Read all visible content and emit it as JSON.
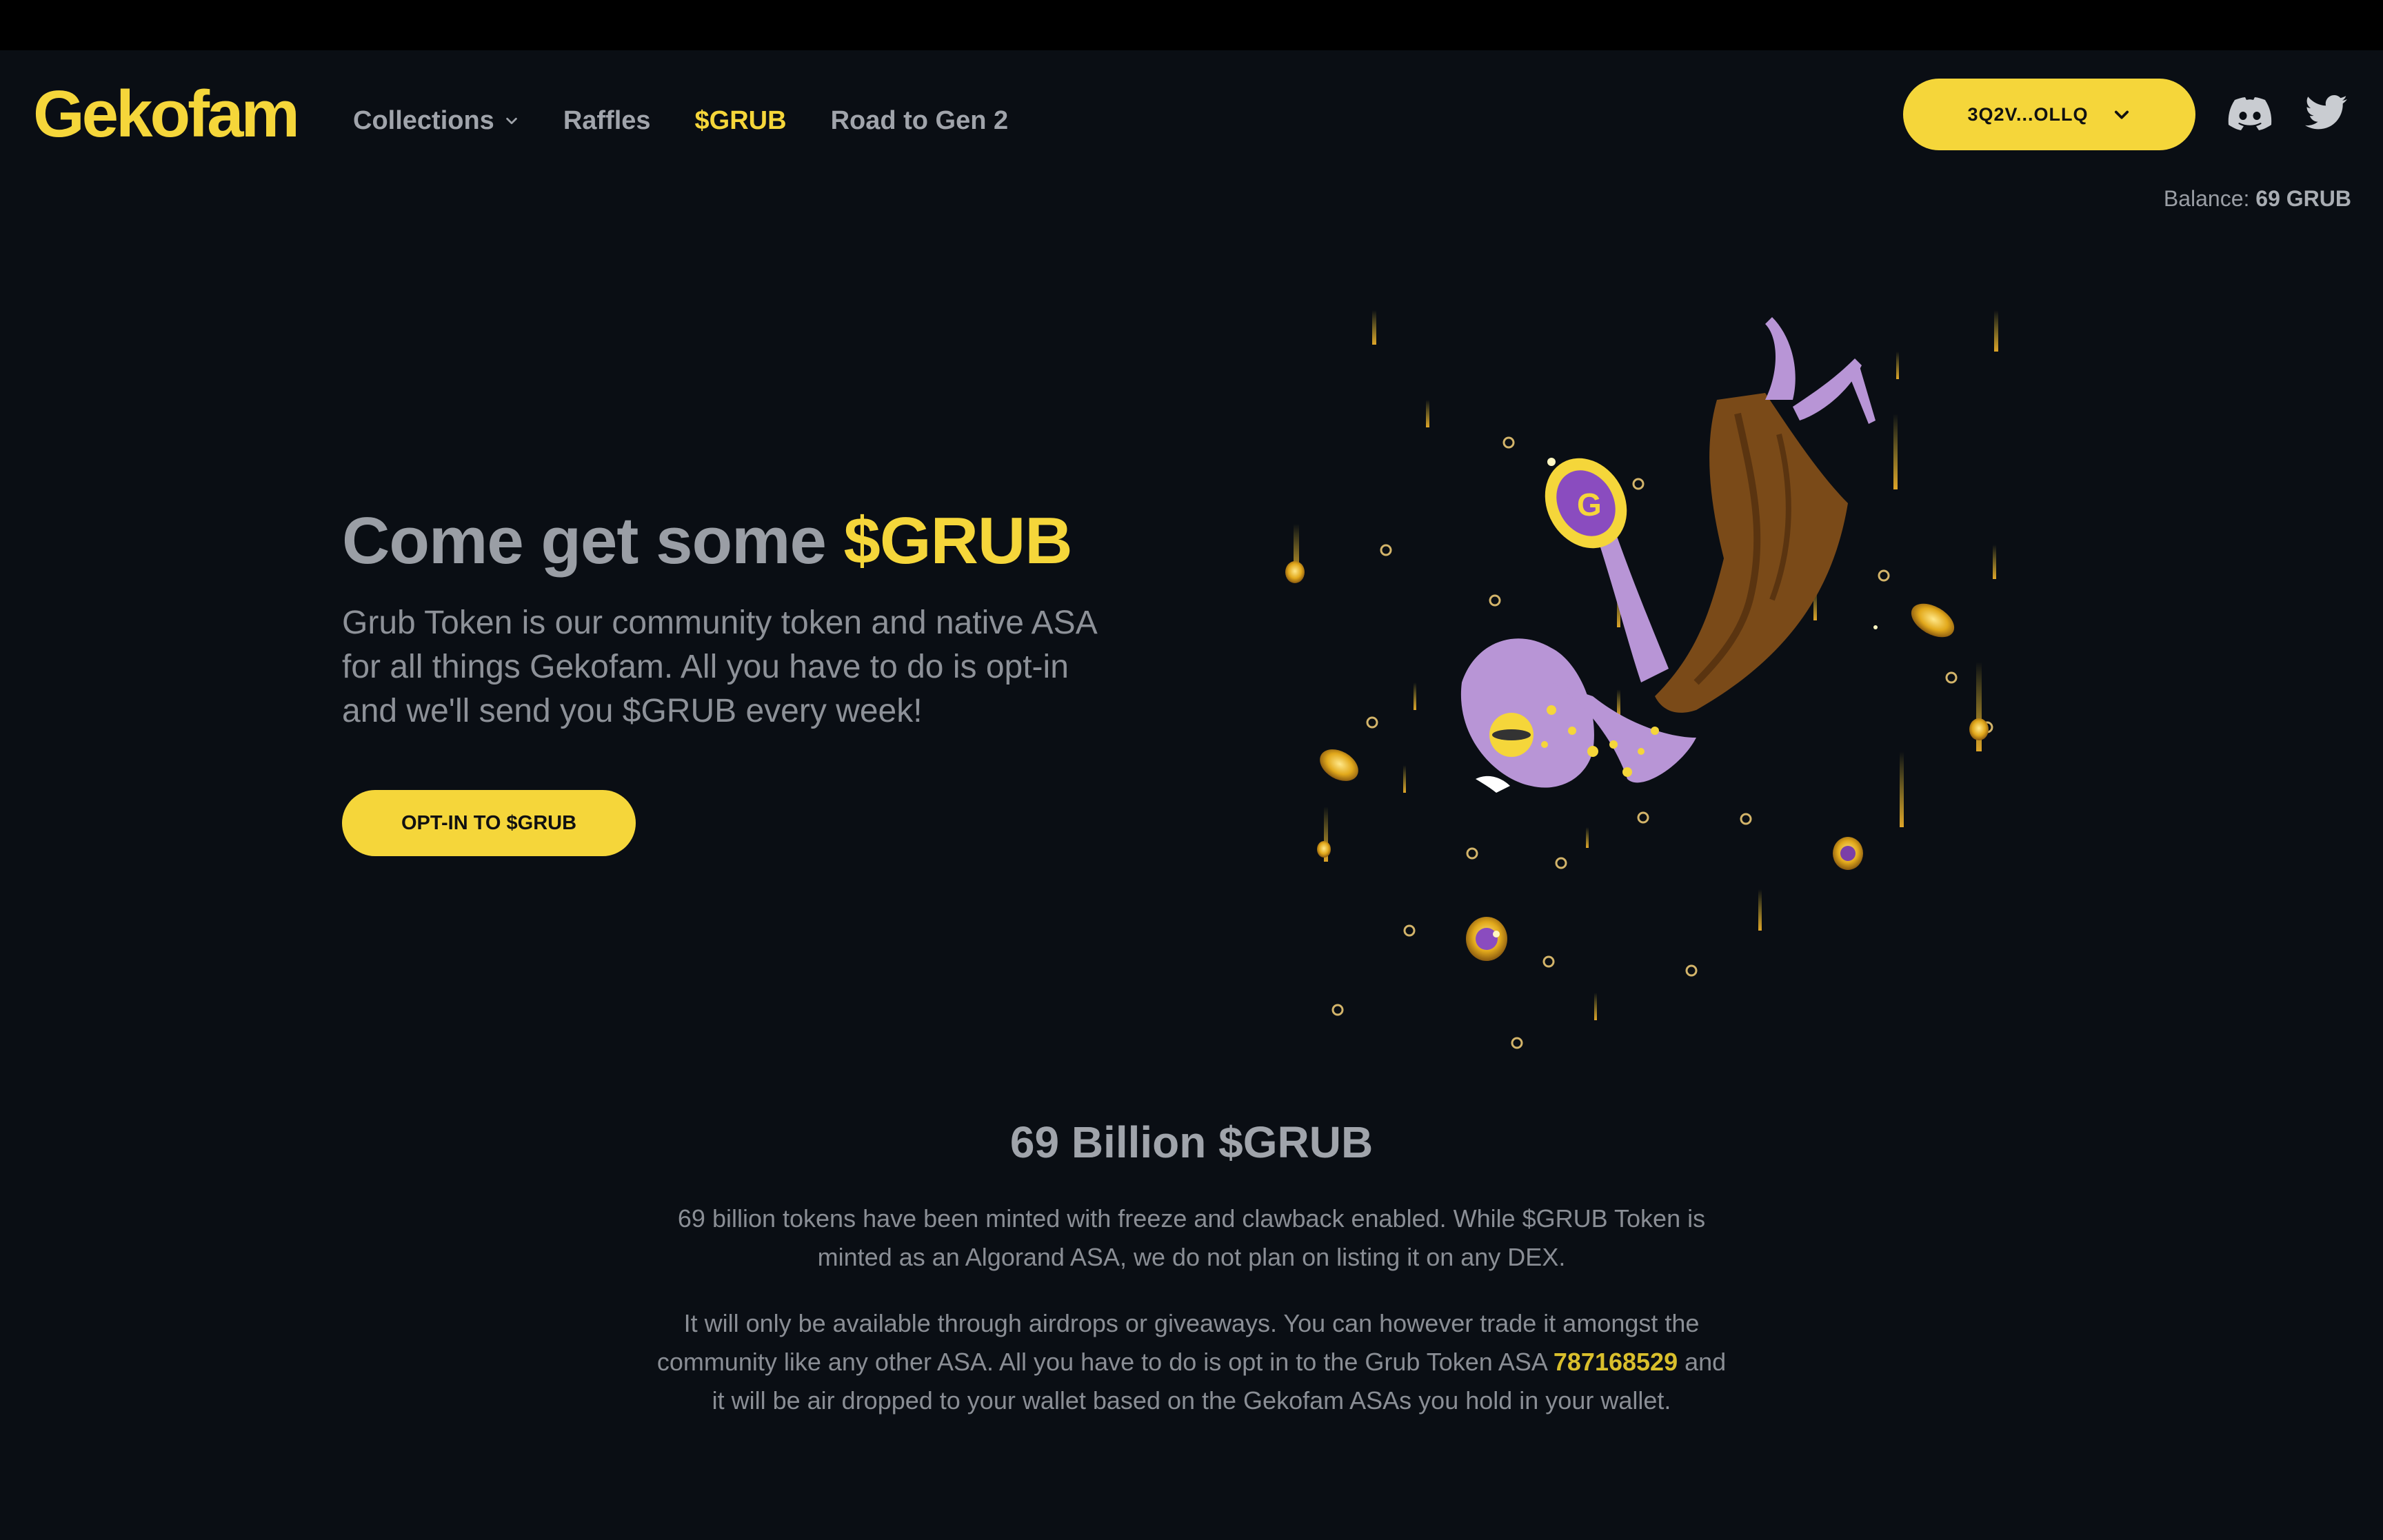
{
  "brand": {
    "logo_text": "Gekofam",
    "accent_color": "#f5d63a"
  },
  "nav": {
    "items": [
      {
        "label": "Collections",
        "has_dropdown": true,
        "active": false
      },
      {
        "label": "Raffles",
        "active": false
      },
      {
        "label": "$GRUB",
        "active": true
      },
      {
        "label": "Road to Gen 2",
        "active": false
      }
    ]
  },
  "wallet": {
    "address": "3Q2V...OLLQ",
    "balance_label": "Balance:",
    "balance_value": "69 GRUB"
  },
  "social": {
    "icons": [
      "discord-icon",
      "twitter-icon"
    ]
  },
  "hero": {
    "title_prefix": "Come get some ",
    "title_accent": "$GRUB",
    "description": "Grub Token is our community token and native ASA for all things Gekofam. All you have to do is opt-in and we'll send you $GRUB every week!",
    "cta_label": "OPT-IN TO $GRUB"
  },
  "info": {
    "title": "69 Billion $GRUB",
    "paragraph1": "69 billion tokens have been minted with freeze and clawback enabled. While $GRUB Token is minted as an Algorand ASA, we do not plan on listing it on any DEX.",
    "paragraph2_before": "It will only be available through airdrops or giveaways. You can however trade it amongst the community like any other ASA. All you have to do is opt in to the Grub Token ASA ",
    "asa_id": "787168529",
    "paragraph2_after": " and it will be air dropped to your wallet based on the Gekofam ASAs you hold in your wallet."
  }
}
